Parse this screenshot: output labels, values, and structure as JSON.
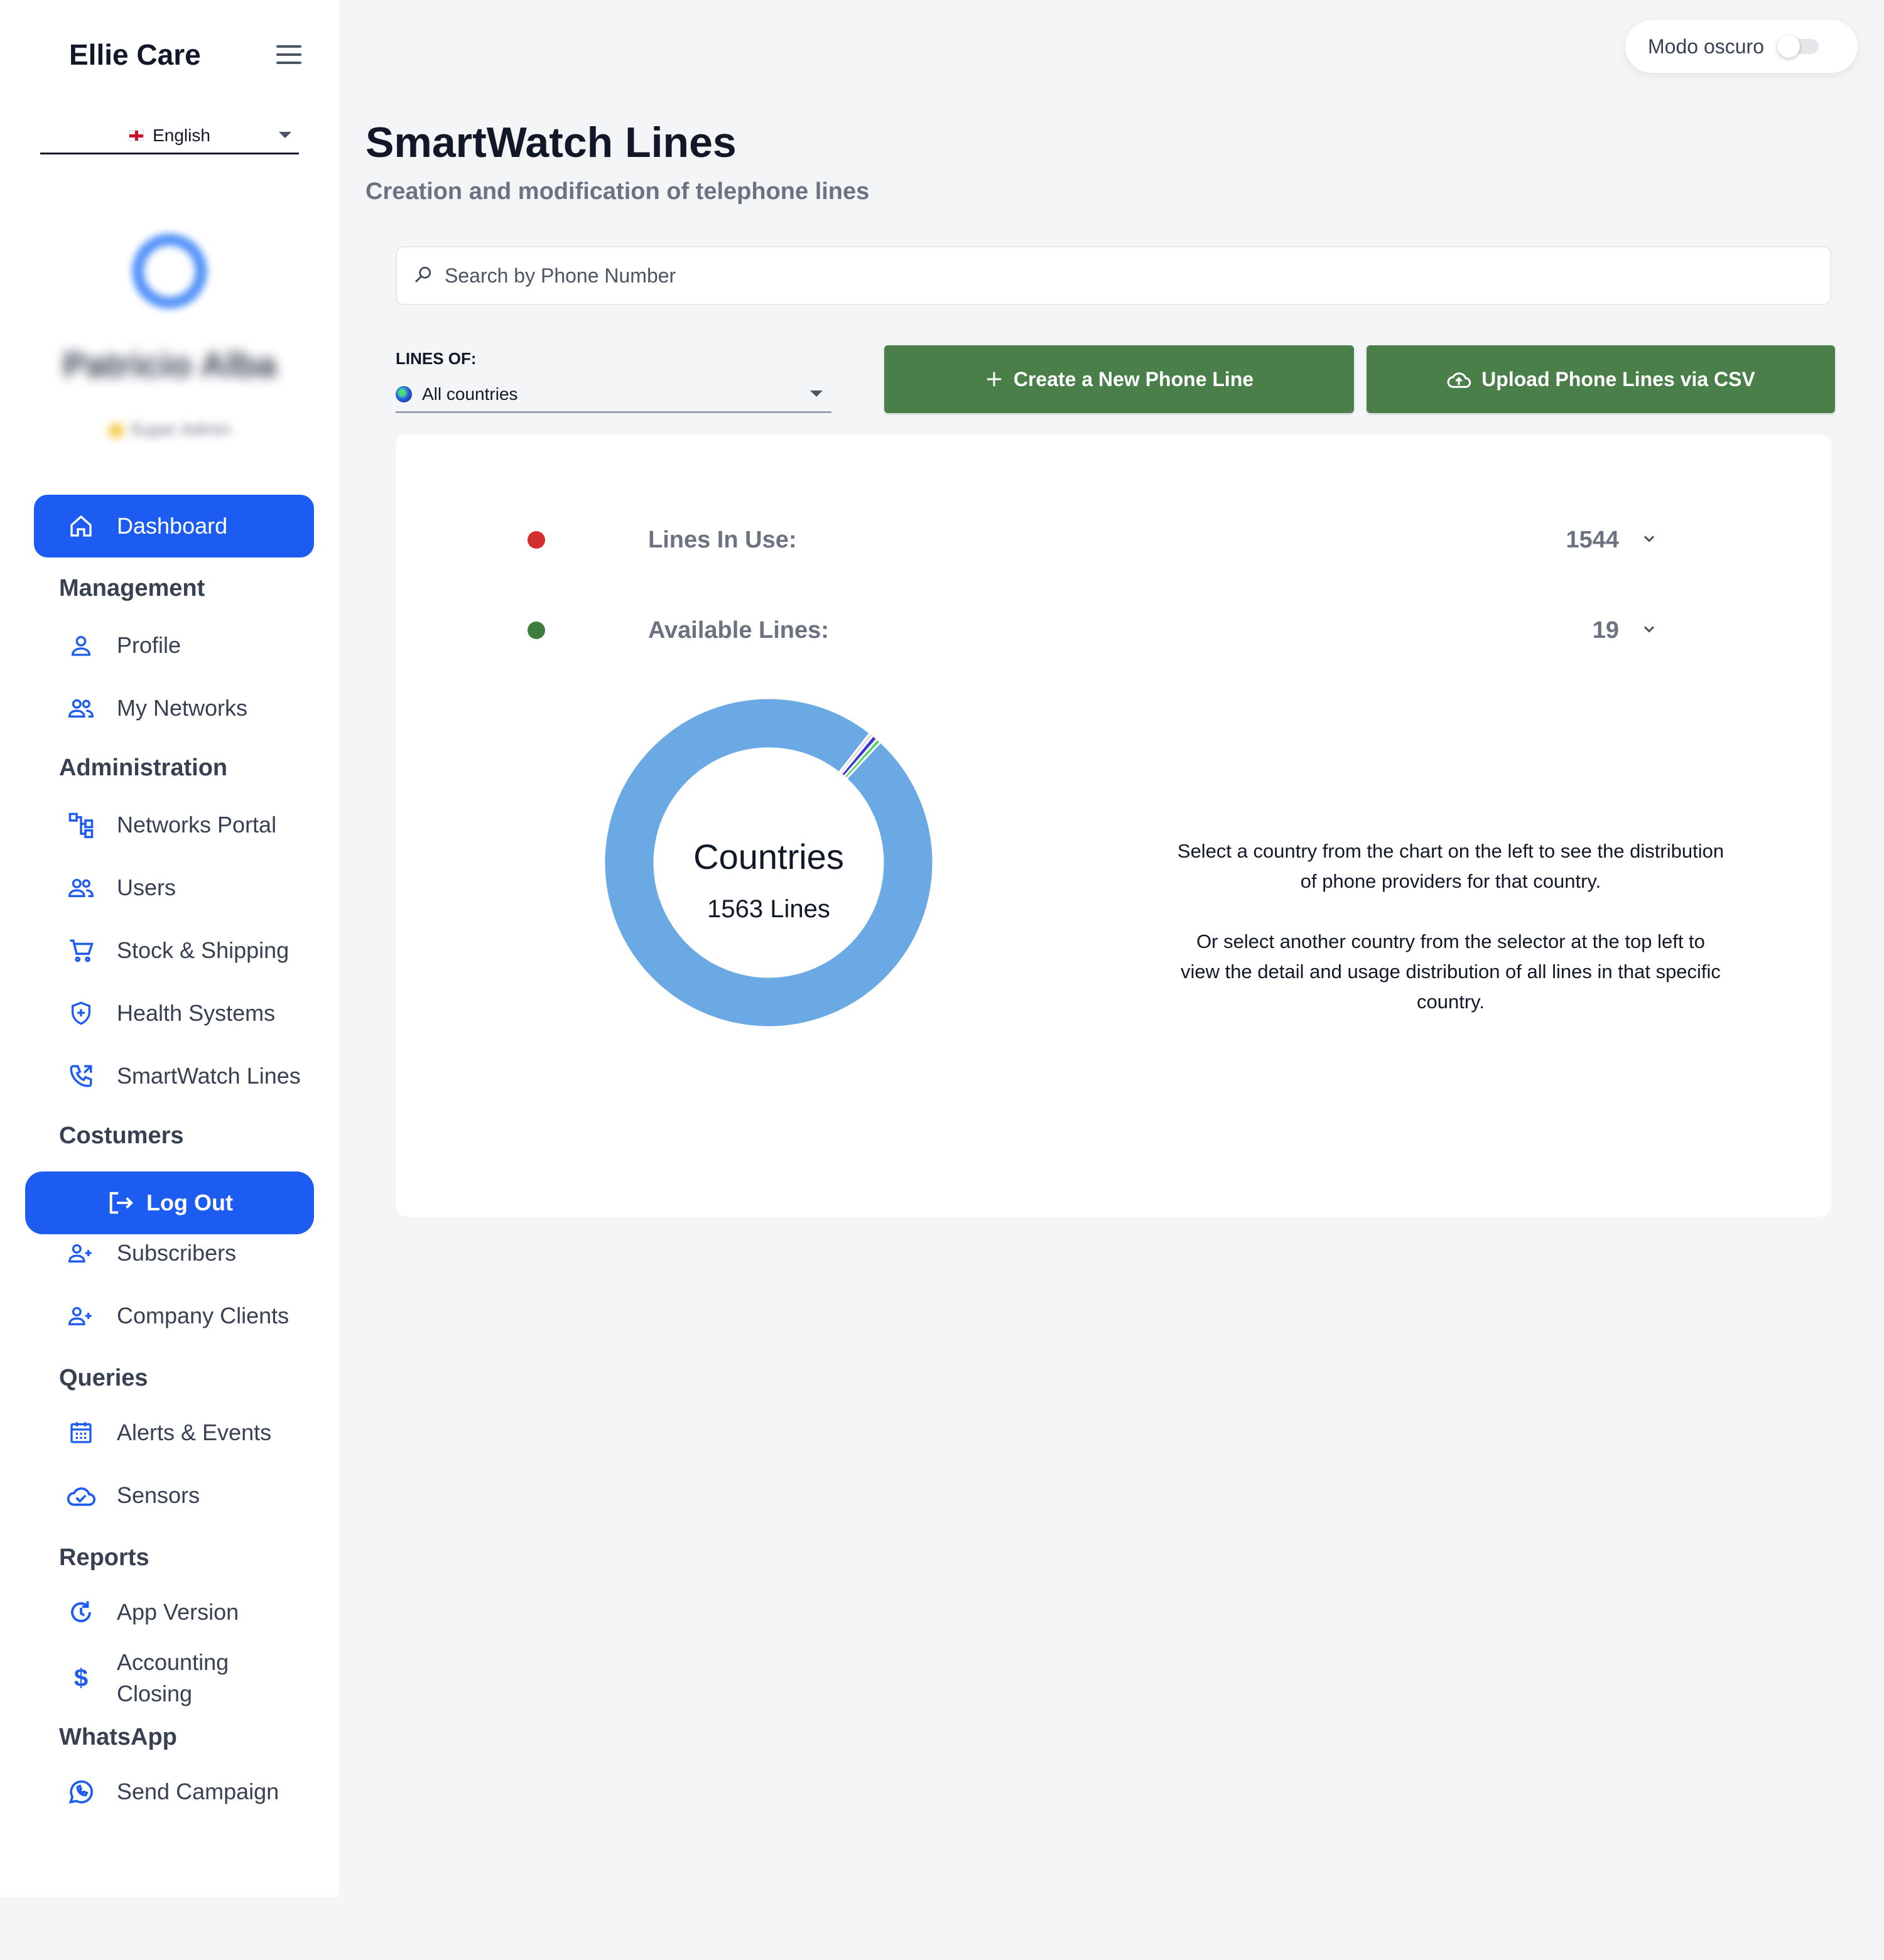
{
  "sidebar": {
    "brand": "Ellie Care",
    "language": "English",
    "user_name": "Patricio Alba",
    "user_role": "Super Admin",
    "items": {
      "dashboard": "Dashboard",
      "management": "Management",
      "profile": "Profile",
      "my_networks": "My Networks",
      "administration": "Administration",
      "networks_portal": "Networks Portal",
      "users": "Users",
      "stock_shipping": "Stock & Shipping",
      "health_systems": "Health Systems",
      "smartwatch_lines": "SmartWatch Lines",
      "costumers": "Costumers",
      "log_out": "Log Out",
      "subscribers": "Subscribers",
      "company_clients": "Company Clients",
      "queries": "Queries",
      "alerts_events": "Alerts & Events",
      "sensors": "Sensors",
      "reports": "Reports",
      "app_version": "App Version",
      "accounting_closing_1": "Accounting",
      "accounting_closing_2": "Closing",
      "whatsapp": "WhatsApp",
      "send_campaign": "Send Campaign"
    }
  },
  "header": {
    "dark_mode_label": "Modo oscuro",
    "dark_mode_on": false
  },
  "main": {
    "title": "SmartWatch Lines",
    "subtitle": "Creation and modification of telephone lines",
    "search_placeholder": "Search by Phone Number",
    "lines_of_label": "LINES OF:",
    "country_selected": "All countries",
    "create_button": "Create a New Phone Line",
    "upload_button": "Upload Phone Lines via CSV"
  },
  "stats": {
    "in_use_label": "Lines In Use:",
    "in_use_value": "1544",
    "in_use_color": "#d32f2f",
    "available_label": "Available Lines:",
    "available_value": "19",
    "available_color": "#3e7d3e"
  },
  "chart_data": {
    "type": "pie",
    "center_title": "Countries",
    "center_subtitle": "1563 Lines",
    "slices": [
      {
        "value": 1542,
        "color": "#6aa9e3"
      },
      {
        "value": 8,
        "color": "#3a3ad6"
      },
      {
        "value": 7,
        "color": "#5bd16a"
      },
      {
        "value": 6,
        "color": "#e6d1e6"
      }
    ]
  },
  "info": {
    "paragraph1": "Select a country from the chart on the left to see the distribution of phone providers for that country.",
    "paragraph2": "Or select another country from the selector at the top left to view the detail and usage distribution of all lines in that specific country."
  }
}
